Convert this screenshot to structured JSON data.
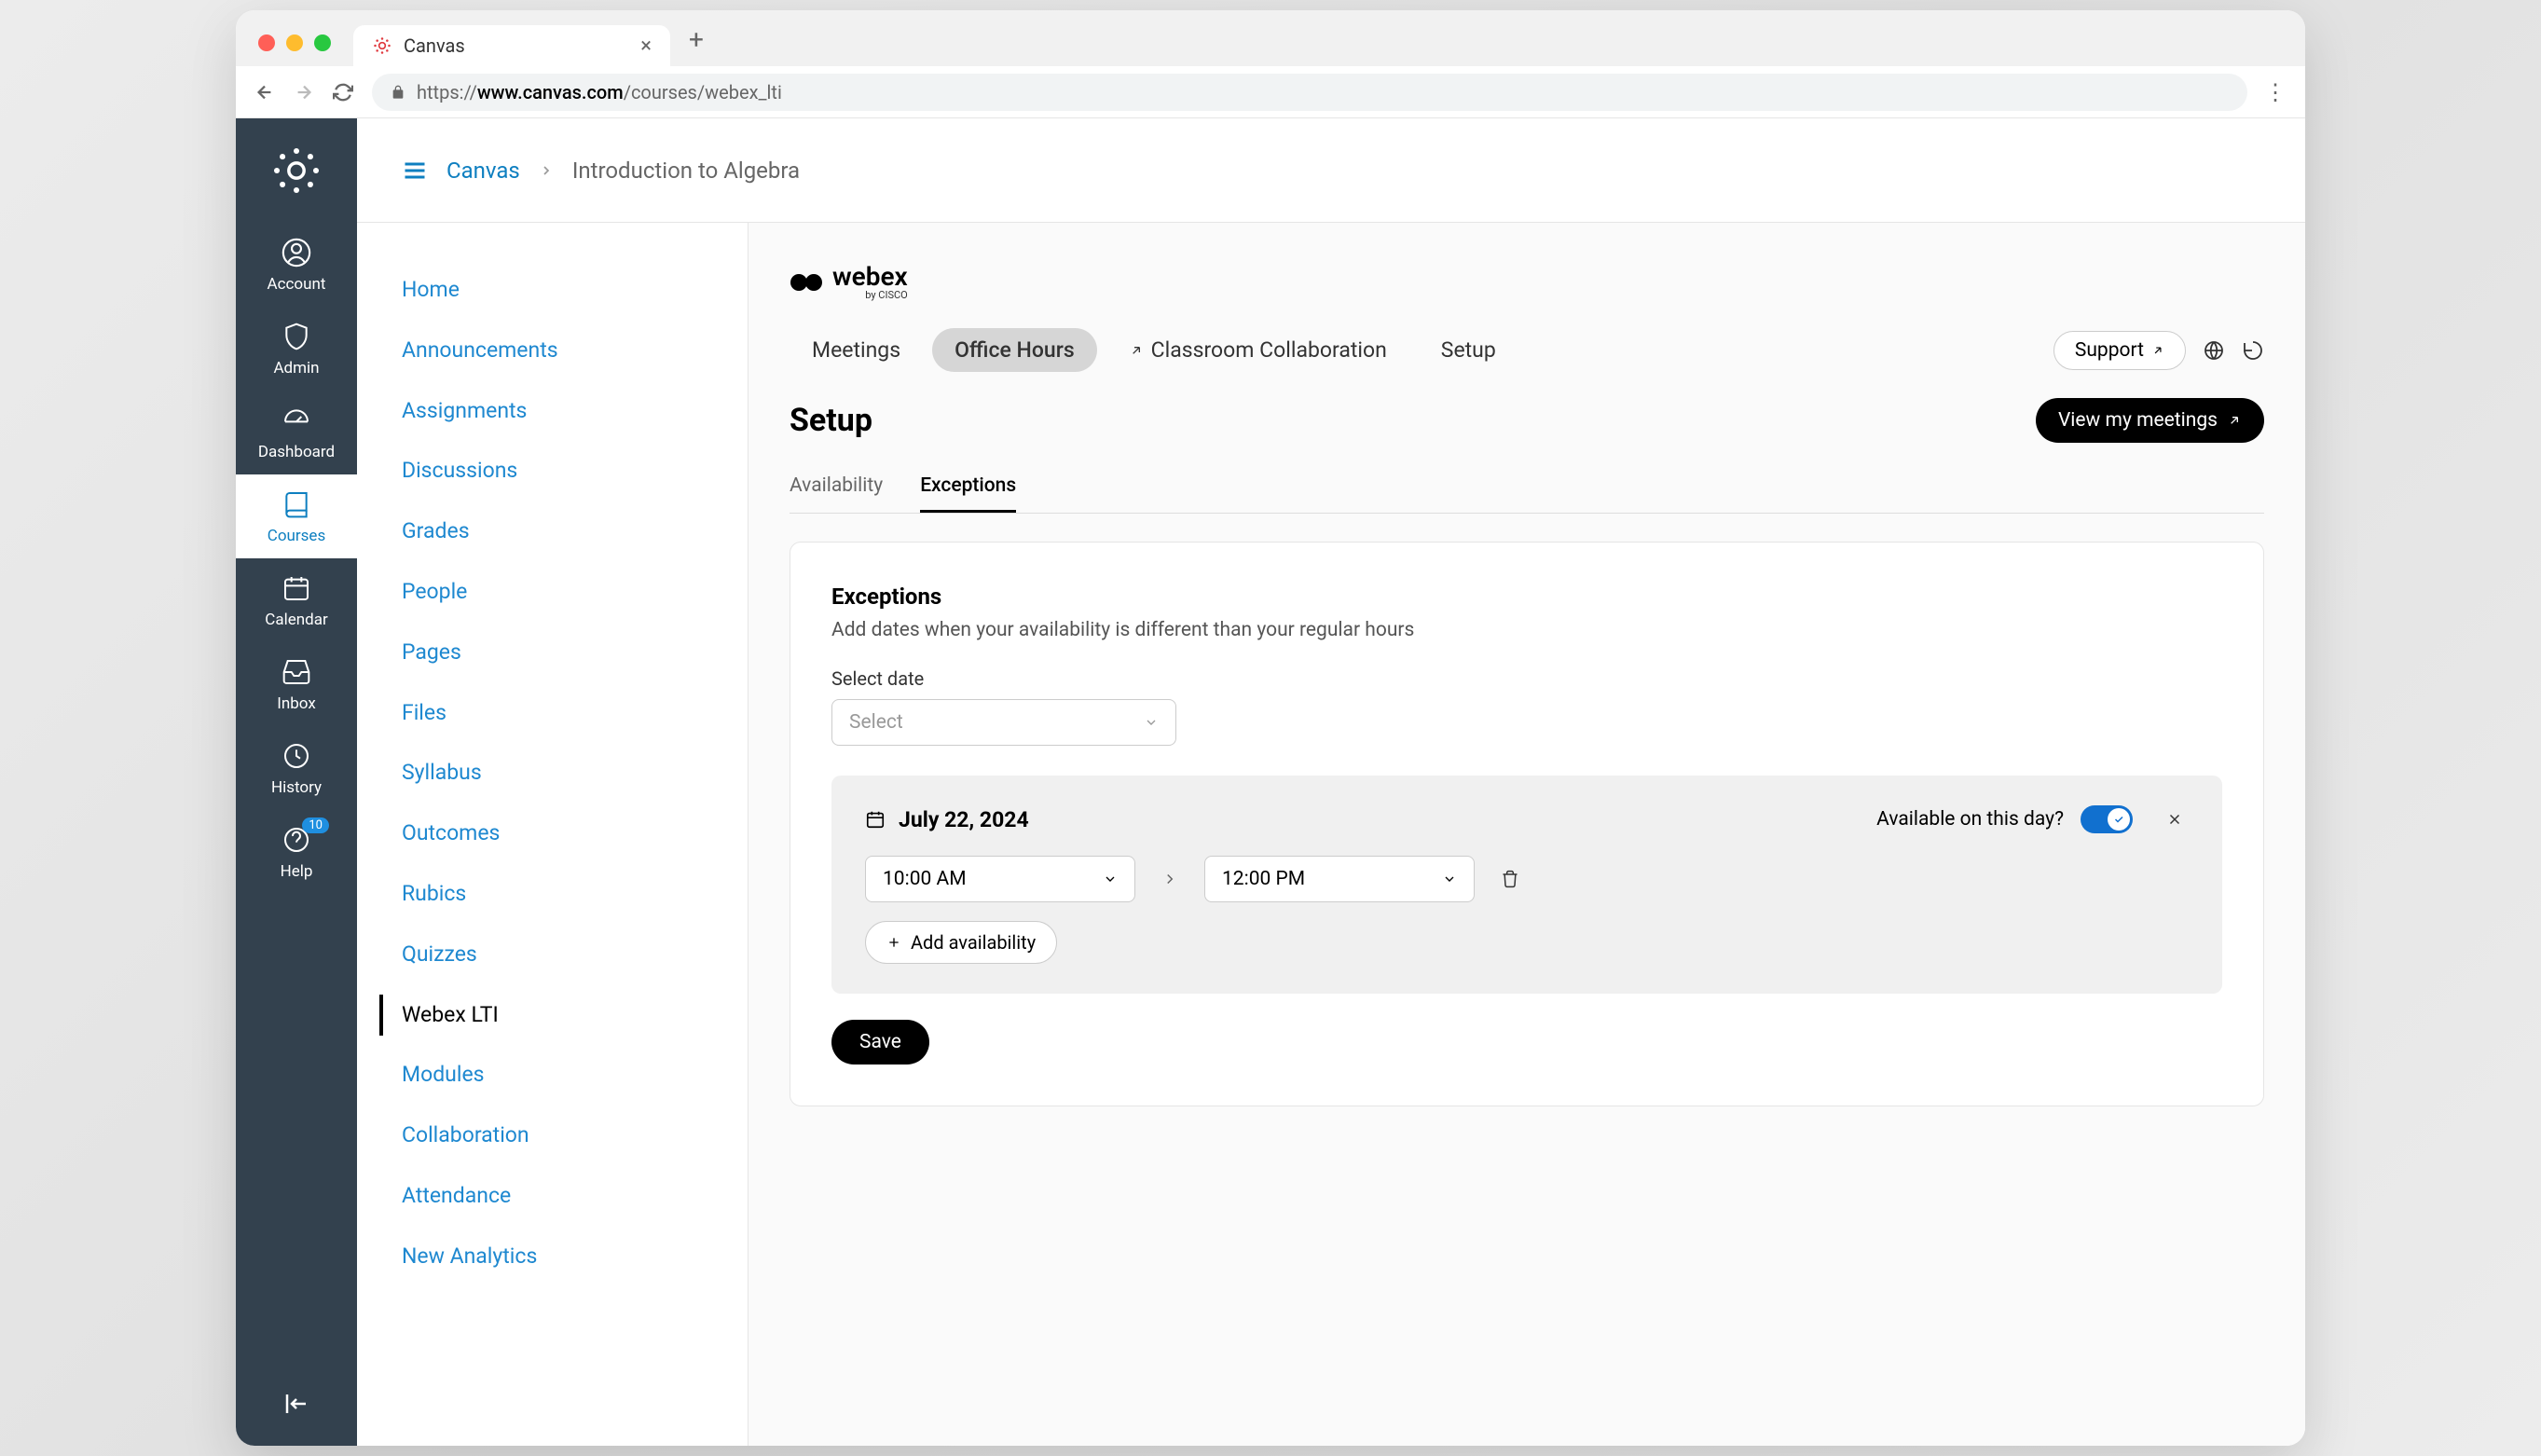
{
  "browser": {
    "tab_title": "Canvas",
    "url_prefix": "https://",
    "url_domain": "www.canvas.com",
    "url_path": "/courses/webex_lti"
  },
  "breadcrumb": {
    "root": "Canvas",
    "current": "Introduction to Algebra"
  },
  "global_nav": {
    "items": [
      {
        "label": "Account"
      },
      {
        "label": "Admin"
      },
      {
        "label": "Dashboard"
      },
      {
        "label": "Courses"
      },
      {
        "label": "Calendar"
      },
      {
        "label": "Inbox"
      },
      {
        "label": "History"
      },
      {
        "label": "Help"
      }
    ],
    "help_badge": "10"
  },
  "course_nav": {
    "items": [
      "Home",
      "Announcements",
      "Assignments",
      "Discussions",
      "Grades",
      "People",
      "Pages",
      "Files",
      "Syllabus",
      "Outcomes",
      "Rubics",
      "Quizzes",
      "Webex LTI",
      "Modules",
      "Collaboration",
      "Attendance",
      "New Analytics"
    ],
    "selected": "Webex LTI"
  },
  "webex": {
    "logo_text": "webex",
    "logo_sub": "by CISCO",
    "tabs": {
      "meetings": "Meetings",
      "office_hours": "Office Hours",
      "classroom": "Classroom Collaboration",
      "setup": "Setup"
    },
    "support_label": "Support",
    "section_title": "Setup",
    "view_meetings_label": "View my meetings",
    "sub_tabs": {
      "availability": "Availability",
      "exceptions": "Exceptions"
    },
    "card": {
      "title": "Exceptions",
      "desc": "Add dates when your availability is different than your regular hours",
      "select_date_label": "Select date",
      "select_placeholder": "Select",
      "exception_date": "July 22, 2024",
      "available_label": "Available on this day?",
      "time_start": "10:00 AM",
      "time_end": "12:00 PM",
      "add_availability_label": "Add availability",
      "save_label": "Save"
    }
  }
}
